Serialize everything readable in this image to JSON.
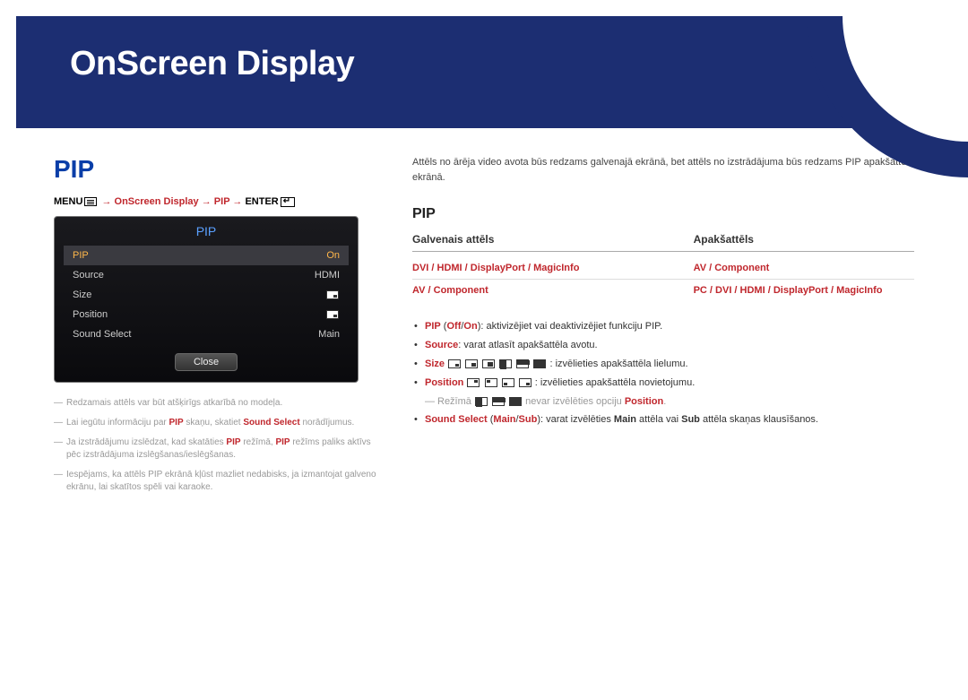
{
  "chapter": {
    "title": "OnScreen Display"
  },
  "left": {
    "heading": "PIP",
    "breadcrumb": {
      "menu": "MENU",
      "path1": "OnScreen Display",
      "path2": "PIP",
      "enter": "ENTER"
    },
    "osd": {
      "title": "PIP",
      "rows": [
        {
          "label": "PIP",
          "value": "On",
          "selected": true
        },
        {
          "label": "Source",
          "value": "HDMI"
        },
        {
          "label": "Size",
          "value": ""
        },
        {
          "label": "Position",
          "value": ""
        },
        {
          "label": "Sound Select",
          "value": "Main"
        }
      ],
      "close": "Close"
    },
    "footnotes": [
      {
        "text": "Redzamais attēls var būt atšķirīgs atkarībā no modeļa."
      },
      {
        "pre": "Lai iegūtu informāciju par ",
        "b1": "PIP",
        "mid": " skaņu, skatiet ",
        "b2": "Sound Select",
        "post": " norādījumus."
      },
      {
        "pre": "Ja izstrādājumu izslēdzat, kad skatāties ",
        "b1": "PIP",
        "mid": " režīmā, ",
        "b2": "PIP",
        "post": " režīms paliks aktīvs pēc izstrādājuma izslēgšanas/ieslēgšanas."
      },
      {
        "text": "Iespējams, ka attēls PIP ekrānā kļūst mazliet nedabisks, ja izmantojat galveno ekrānu, lai skatītos spēli vai karaoke."
      }
    ]
  },
  "right": {
    "intro": "Attēls no ārēja video avota būs redzams galvenajā ekrānā, bet attēls no izstrādājuma būs redzams PIP apakšattēla ekrānā.",
    "subheading": "PIP",
    "table": {
      "header": {
        "col1": "Galvenais attēls",
        "col2": "Apakšattēls"
      },
      "rows": [
        {
          "col1": "DVI / HDMI / DisplayPort / MagicInfo",
          "col2": "AV / Component"
        },
        {
          "col1": "AV / Component",
          "col2": "PC / DVI / HDMI / DisplayPort / MagicInfo"
        }
      ]
    },
    "bullets": {
      "pip": {
        "label": "PIP",
        "paren1": "Off",
        "paren2": "On",
        "tail": ": aktivizējiet vai deaktivizējiet funkciju PIP."
      },
      "source": {
        "label": "Source",
        "tail": ": varat atlasīt apakšattēla avotu."
      },
      "size": {
        "label": "Size",
        "tail": ": izvēlieties apakšattēla lielumu."
      },
      "position": {
        "label": "Position",
        "tail": ": izvēlieties apakšattēla novietojumu."
      },
      "position_sub": {
        "pre": "Režīmā ",
        "mid": " nevar izvēlēties opciju ",
        "opt": "Position",
        "post": "."
      },
      "sound": {
        "label": "Sound Select",
        "paren1": "Main",
        "paren2": "Sub",
        "mid1": ": varat izvēlēties ",
        "b1": "Main",
        "mid2": " attēla vai ",
        "b2": "Sub",
        "tail": " attēla skaņas klausīšanos."
      }
    }
  }
}
